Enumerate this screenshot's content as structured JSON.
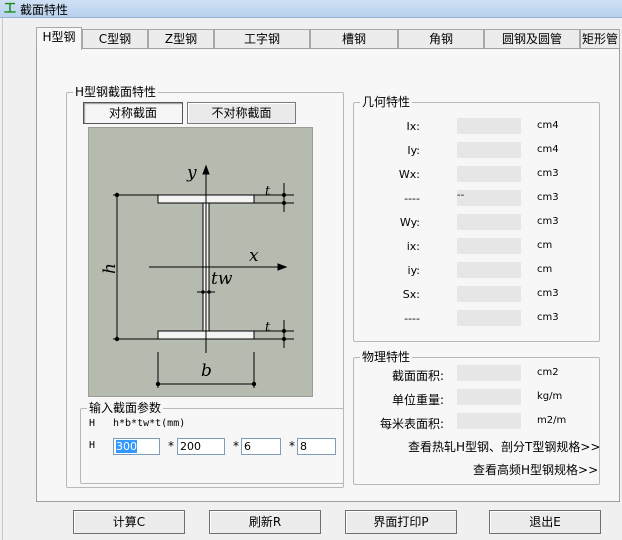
{
  "window": {
    "title": "截面特性"
  },
  "tabs": [
    "H型钢",
    "C型钢",
    "Z型钢",
    "工字钢",
    "槽钢",
    "角钢",
    "圆钢及圆管",
    "矩形管"
  ],
  "section_group": {
    "legend": "H型钢截面特性",
    "symmetric_label": "对称截面",
    "asymmetric_label": "不对称截面"
  },
  "diagram": {
    "y": "y",
    "x": "x",
    "h": "h",
    "b": "b",
    "tw": "tw",
    "t_top": "t",
    "t_bottom": "t"
  },
  "input_group": {
    "legend": "输入截面参数",
    "formula_prefix": "H",
    "formula": "h*b*tw*t(mm)",
    "row_prefix": "H",
    "times": "*",
    "values": [
      "300",
      "200",
      "6",
      "8"
    ]
  },
  "geometry": {
    "legend": "几何特性",
    "rows": [
      {
        "label": "Ix:",
        "extra": "",
        "unit": "cm4"
      },
      {
        "label": "Iy:",
        "extra": "",
        "unit": "cm4"
      },
      {
        "label": "Wx:",
        "extra": "",
        "unit": "cm3"
      },
      {
        "label": "----",
        "extra": "--",
        "unit": "cm3"
      },
      {
        "label": "Wy:",
        "extra": "",
        "unit": "cm3"
      },
      {
        "label": "ix:",
        "extra": "",
        "unit": "cm"
      },
      {
        "label": "iy:",
        "extra": "",
        "unit": "cm"
      },
      {
        "label": "Sx:",
        "extra": "",
        "unit": "cm3"
      },
      {
        "label": "----",
        "extra": "",
        "unit": "cm3"
      }
    ]
  },
  "physical": {
    "legend": "物理特性",
    "rows": [
      {
        "label": "截面面积:",
        "unit": "cm2"
      },
      {
        "label": "单位重量:",
        "unit": "kg/m"
      },
      {
        "label": "每米表面积:",
        "unit": "m2/m"
      }
    ],
    "link1": "查看热轧H型钢、剖分T型钢规格>>",
    "link2": "查看高频H型钢规格>>"
  },
  "buttons": {
    "calc": "计算C",
    "refresh": "刷新R",
    "print": "界面打印P",
    "exit": "退出E"
  }
}
